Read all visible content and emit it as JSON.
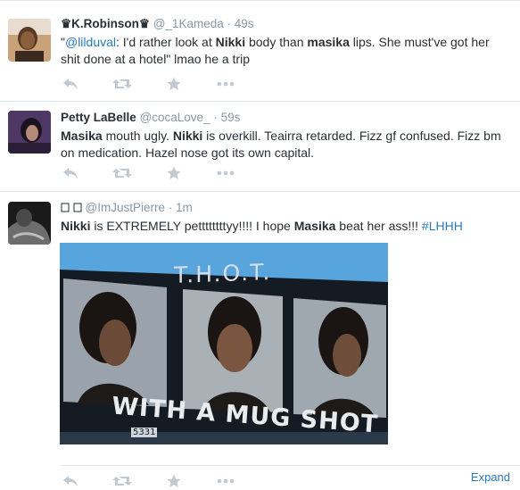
{
  "tweets": [
    {
      "fullname": "♛K.Robinson♛",
      "username": "@_1Kameda",
      "separator": "·",
      "time": "49s",
      "text_parts": [
        "\"",
        "@lilduval",
        ": I'd rather look at ",
        "Nikki",
        " body than ",
        "masika",
        " lips. She must've got her shit done at a hotel\" lmao he a trip"
      ]
    },
    {
      "fullname": "Petty LaBelle",
      "username": "@cocaLove_",
      "separator": "·",
      "time": "59s",
      "text_parts": [
        "Masika",
        " mouth ugly. ",
        "Nikki",
        " is overkill. Teairra retarded. Fizz gf confused. Fizz bm on medication. Hazel nose got its own capital."
      ]
    },
    {
      "fullname": "",
      "username": "@ImJustPierre",
      "separator": "·",
      "time": "1m",
      "text_parts": [
        "Nikki",
        " is EXTREMELY pettttttttyy!!!! I hope ",
        "Masika",
        " beat her ass!!! ",
        "#LHHH"
      ],
      "media": {
        "title": "T.H.O.T.",
        "caption": "WITH A MUG SHOT",
        "sign_number": "5331"
      },
      "expand_label": "Expand"
    }
  ],
  "icons": {
    "reply": "reply-icon",
    "retweet": "retweet-icon",
    "favorite": "star-icon",
    "more": "more-icon"
  },
  "colors": {
    "link": "#2b7bb9",
    "muted": "#8899a6",
    "action": "#c1cad2",
    "text": "#292f33"
  }
}
